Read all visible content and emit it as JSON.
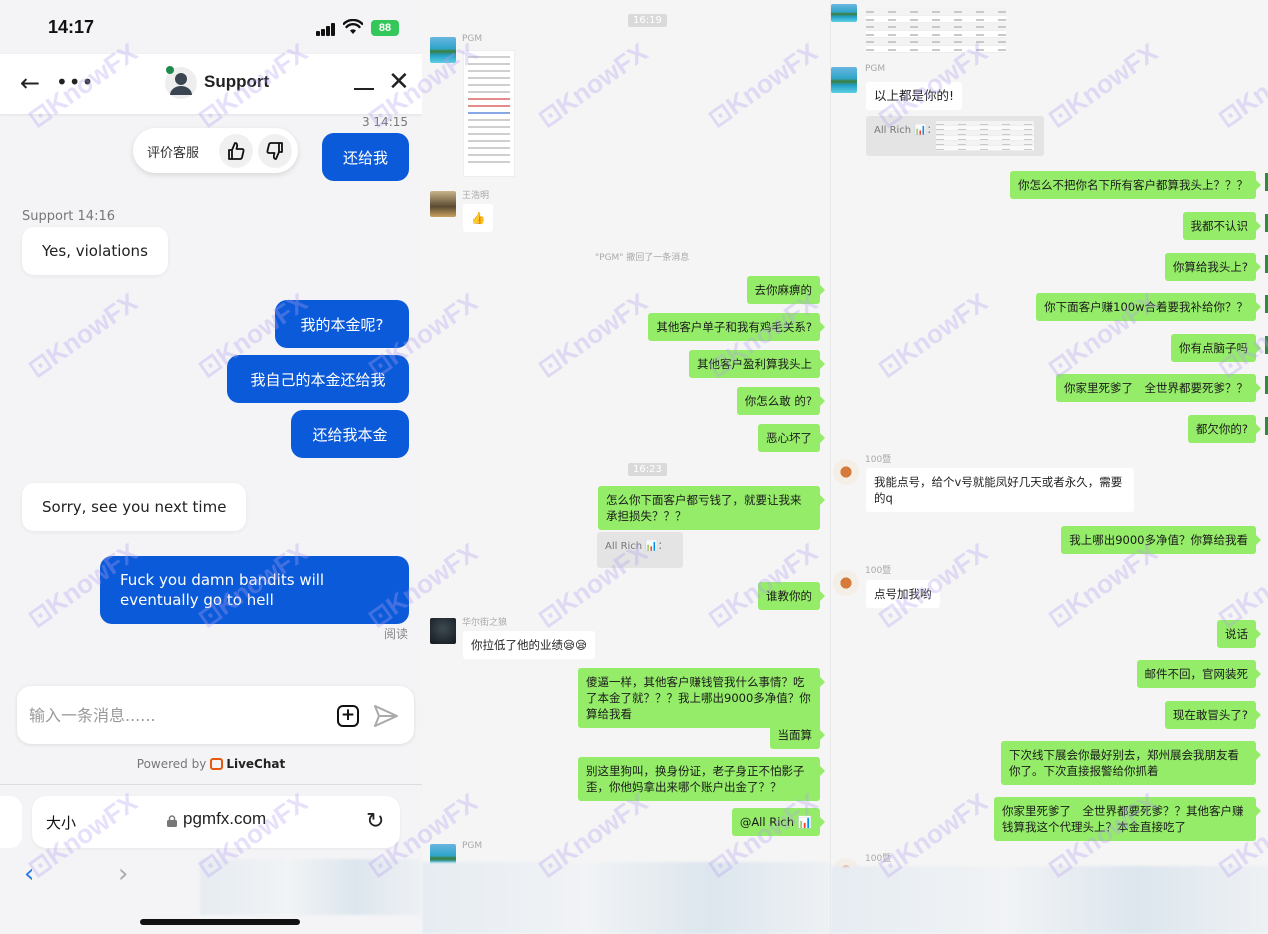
{
  "phone": {
    "status_bar": {
      "time": "14:17",
      "battery": "88"
    },
    "header": {
      "agent_name": "Support",
      "back_icon": "arrow-left-icon",
      "more_icon": "ellipsis-icon",
      "minimize_icon": "minimize-icon",
      "close_icon": "close-icon"
    },
    "rating": {
      "label": "评价客服",
      "thumb_up_icon": "thumbs-up-icon",
      "thumb_down_icon": "thumbs-down-icon"
    },
    "messages": [
      {
        "from": "user",
        "time": "3 14:15",
        "text": "还给我"
      },
      {
        "from": "agent",
        "sender": "Support 14:16",
        "text": "Yes, violations"
      },
      {
        "from": "user",
        "text": "我的本金呢?"
      },
      {
        "from": "user",
        "text": "我自己的本金还给我"
      },
      {
        "from": "user",
        "text": "还给我本金"
      },
      {
        "from": "agent",
        "text": "Sorry, see you next time"
      },
      {
        "from": "user",
        "text": "Fuck you damn bandits will eventually go to hell",
        "status": "阅读"
      }
    ],
    "composer": {
      "placeholder": "输入一条消息......",
      "attach_icon": "plus-square-icon",
      "send_icon": "send-icon"
    },
    "powered_by": {
      "prefix": "Powered by",
      "brand": "LiveChat"
    },
    "browser": {
      "text_size_label": "大小",
      "url": "pgmfx.com",
      "reload_icon": "reload-icon"
    }
  },
  "chat_mid": {
    "timestamps": [
      "16:19",
      "16:23"
    ],
    "recall_notice": "\"PGM\" 撤回了一条消息",
    "senders": {
      "pgm": "PGM",
      "wang": "王浩明",
      "wolf": "华尔街之狼"
    },
    "incoming": [
      {
        "sender": "王浩明",
        "text": "👍"
      },
      {
        "sender": "华尔街之狼",
        "text": "你拉低了他的业绩😪😪"
      }
    ],
    "outgoing": [
      "去你麻痹的",
      "其他客户单子和我有鸡毛关系?",
      "其他客户盈利算我头上",
      "你怎么敢 的?",
      "恶心坏了",
      "怎么你下面客户都亏钱了，就要让我来承担损失？？？",
      "谁教你的",
      "傻逼一样，其他客户赚钱管我什么事情？吃了本金了就？？？我上哪出9000多净值？你算给我看",
      "当面算",
      "别这里狗叫，换身份证，老子身正不怕影子歪，你他妈拿出来哪个账户出金了？？",
      "@All Rich 📊"
    ],
    "quote_label": "All Rich 📊："
  },
  "chat_right": {
    "senders": {
      "pgm": "PGM",
      "user100": "100暨"
    },
    "incoming": [
      {
        "sender": "PGM",
        "text": "以上都是你的!"
      },
      {
        "sender": "100暨",
        "text": "我能点号，给个v号就能凤好几天或者永久，需要的q"
      },
      {
        "sender": "100暨",
        "text": "点号加我哟"
      }
    ],
    "quote_label": "All Rich 📊：",
    "outgoing": [
      "你怎么不把你名下所有客户都算我头上？？？",
      "我都不认识",
      "你算给我头上?",
      "你下面客户赚100w合着要我补给你？？",
      "你有点脑子吗",
      "你家里死爹了　全世界都要死爹？？",
      "都欠你的?",
      "我上哪出9000多净值？你算给我看",
      "说话",
      "邮件不回，官网装死",
      "现在敢冒头了?",
      "下次线下展会你最好别去，郑州展会我朋友看你了。下次直接报警给你抓着",
      "你家里死爹了　全世界都要死爹？？其他客户赚钱算我这个代理头上？本金直接吃了"
    ]
  },
  "watermark": "KnowFX"
}
